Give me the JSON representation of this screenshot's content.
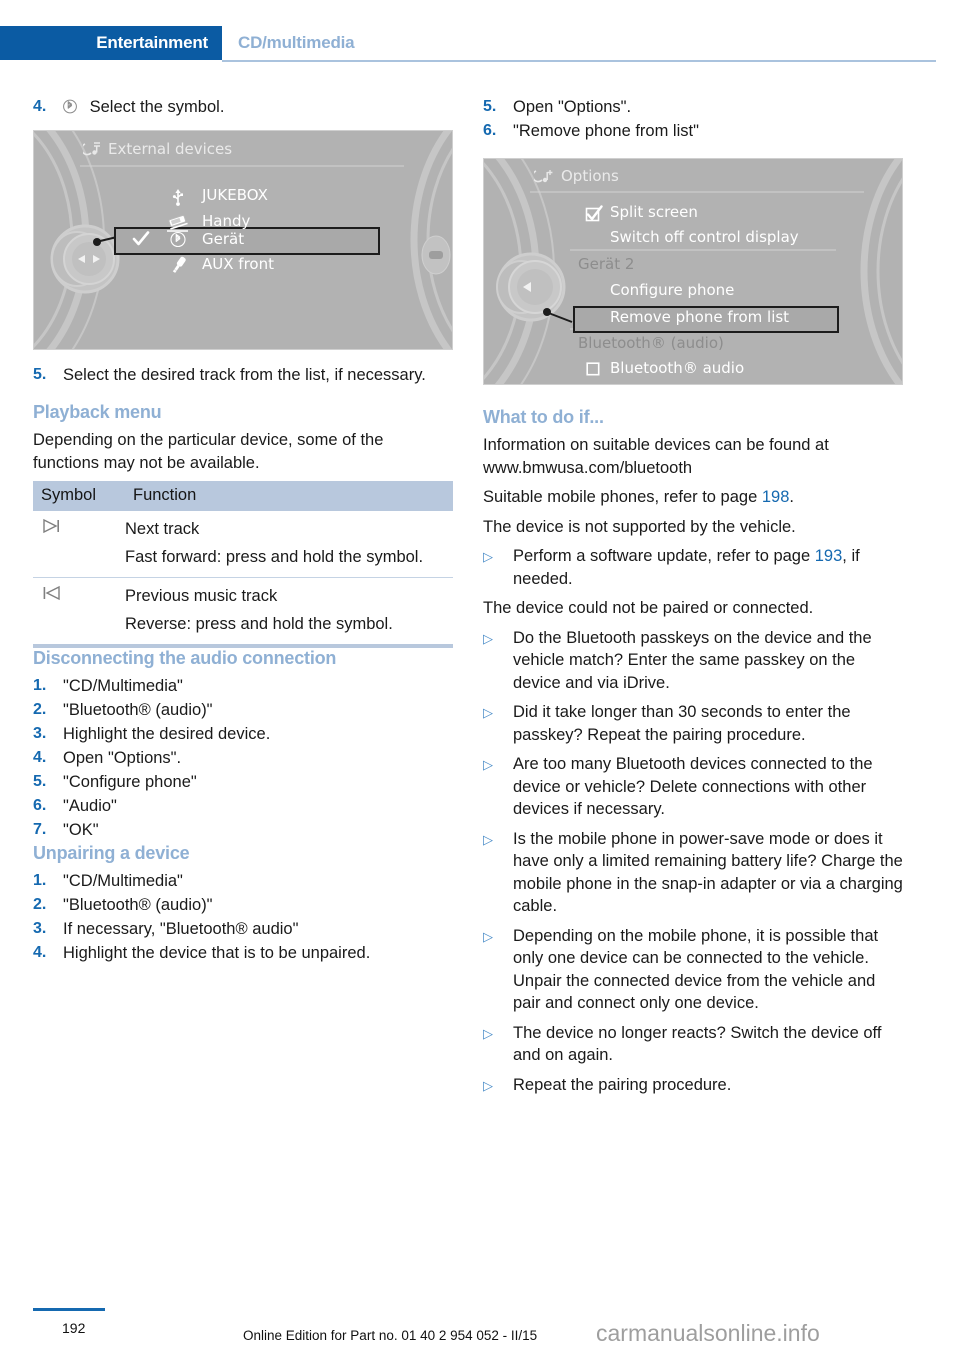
{
  "header": {
    "tab_active": "Entertainment",
    "tab_sub": "CD/multimedia",
    "accent_color": "#0b5ba3",
    "muted_color": "#8fb0d4"
  },
  "left_column": {
    "step4": {
      "num": "4.",
      "icon": "bluetooth-icon",
      "text": "Select the symbol."
    },
    "screenshot_external_devices": {
      "name": "external-devices-screen",
      "title": "External devices",
      "title_icon": "multimedia-icon",
      "items": [
        {
          "icon": "usb-icon",
          "label": "JUKEBOX",
          "checked": false,
          "selected": false
        },
        {
          "icon": "snap-in-adapter-icon",
          "label": "Handy",
          "checked": false,
          "selected": false
        },
        {
          "icon": "bluetooth-icon",
          "label": "Gerät",
          "checked": true,
          "selected": true
        },
        {
          "icon": "aux-jack-icon",
          "label": "AUX front",
          "checked": false,
          "selected": false
        }
      ]
    },
    "step5": {
      "num": "5.",
      "text": "Select the desired track from the list, if necessary."
    },
    "playback_menu": {
      "heading": "Playback menu",
      "intro": "Depending on the particular device, some of the functions may not be available.",
      "table": {
        "headers": [
          "Symbol",
          "Function"
        ],
        "rows": [
          {
            "symbol": "▷|",
            "symbol_name": "next-track-icon",
            "function": "Next track",
            "detail": "Fast forward: press and hold the symbol."
          },
          {
            "symbol": "|◁",
            "symbol_name": "previous-track-icon",
            "function": "Previous music track",
            "detail": "Reverse: press and hold the symbol."
          }
        ]
      }
    },
    "disconnecting": {
      "heading": "Disconnecting the audio connection",
      "steps": [
        {
          "num": "1.",
          "text": "\"CD/Multimedia\""
        },
        {
          "num": "2.",
          "text": "\"Bluetooth® (audio)\""
        },
        {
          "num": "3.",
          "text": "Highlight the desired device."
        },
        {
          "num": "4.",
          "text": "Open \"Options\"."
        },
        {
          "num": "5.",
          "text": "\"Configure phone\""
        },
        {
          "num": "6.",
          "text": "\"Audio\""
        },
        {
          "num": "7.",
          "text": "\"OK\""
        }
      ]
    },
    "unpairing": {
      "heading": "Unpairing a device",
      "steps": [
        {
          "num": "1.",
          "text": "\"CD/Multimedia\""
        },
        {
          "num": "2.",
          "text": "\"Bluetooth® (audio)\""
        },
        {
          "num": "3.",
          "text": "If necessary, \"Bluetooth® audio\""
        },
        {
          "num": "4.",
          "text": "Highlight the device that is to be unpaired."
        }
      ]
    }
  },
  "right_column": {
    "step5": {
      "num": "5.",
      "text": "Open \"Options\"."
    },
    "step6": {
      "num": "6.",
      "text": "\"Remove phone from list\""
    },
    "screenshot_options": {
      "name": "options-screen",
      "title": "Options",
      "title_icon": "multimedia-options-icon",
      "items": [
        {
          "icon": "checkbox-checked-icon",
          "label": "Split screen",
          "type": "checkbox",
          "checked": true
        },
        {
          "icon": "",
          "label": "Switch off control display",
          "type": "item"
        },
        {
          "icon": "",
          "label": "Gerät 2",
          "type": "group-heading"
        },
        {
          "icon": "",
          "label": "Configure phone",
          "type": "item"
        },
        {
          "icon": "",
          "label": "Remove phone from list",
          "type": "item",
          "selected": true
        },
        {
          "icon": "",
          "label": "Bluetooth® (audio)",
          "type": "group-heading"
        },
        {
          "icon": "checkbox-unchecked-icon",
          "label": "Bluetooth® audio",
          "type": "checkbox",
          "checked": false
        }
      ]
    },
    "what_to_do": {
      "heading": "What to do if...",
      "paragraphs": [
        "Information on suitable devices can be found at www.bmwusa.com/bluetooth"
      ],
      "suitable_phones_pre": "Suitable mobile phones, refer to page ",
      "suitable_phones_page": "198",
      "suitable_phones_post": ".",
      "not_supported": "The device is not supported by the vehicle.",
      "software_update_pre": "Perform a software update, refer to page ",
      "software_update_page": "193",
      "software_update_post": ", if needed.",
      "not_paired": "The device could not be paired or connected.",
      "bullets": [
        "Do the Bluetooth passkeys on the device and the vehicle match? Enter the same passkey on the device and via iDrive.",
        "Did it take longer than 30 seconds to enter the passkey? Repeat the pairing procedure.",
        "Are too many Bluetooth devices connected to the device or vehicle? Delete connections with other devices if necessary.",
        "Is the mobile phone in power-save mode or does it have only a limited remaining battery life? Charge the mobile phone in the snap-in adapter or via a charging cable.",
        "Depending on the mobile phone, it is possible that only one device can be connected to the vehicle. Unpair the connected device from the vehicle and pair and connect only one device.",
        "The device no longer reacts? Switch the device off and on again.",
        "Repeat the pairing procedure."
      ]
    }
  },
  "footer": {
    "page_number": "192",
    "edition": "Online Edition for Part no. 01 40 2 954 052 - II/15",
    "watermark": "carmanualsonline.info"
  }
}
